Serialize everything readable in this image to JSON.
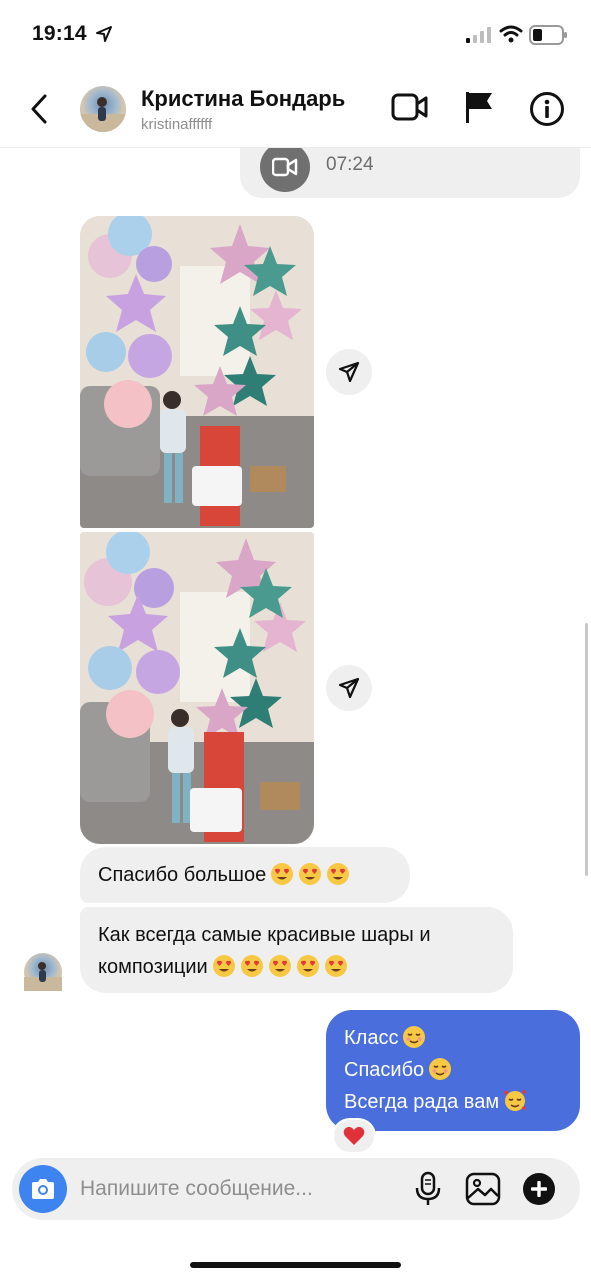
{
  "status_bar": {
    "time": "19:14"
  },
  "header": {
    "contact_name": "Кристина Бондарь",
    "username": "kristinaffffff",
    "icons": [
      "back-arrow-icon",
      "video-call-icon",
      "flag-icon",
      "info-icon"
    ]
  },
  "chat": {
    "call_time": "07:24",
    "photos": [
      "balloons-photo-1",
      "balloons-photo-2"
    ],
    "incoming": [
      {
        "text": "Спасибо большое",
        "emojis": [
          "heart-eyes",
          "heart-eyes",
          "heart-eyes"
        ]
      },
      {
        "text_line1": "Как всегда самые красивые шары и",
        "text_line2": "композиции",
        "emojis": [
          "heart-eyes",
          "heart-eyes",
          "heart-eyes",
          "heart-eyes",
          "heart-eyes"
        ]
      }
    ],
    "outgoing": {
      "line1": "Класс",
      "line2": "Спасибо",
      "line3": "Всегда рада вам",
      "emojis": [
        "relieved-smile",
        "relieved-smile",
        "smiling-hearts"
      ]
    },
    "reaction": "❤️"
  },
  "composer": {
    "placeholder": "Напишите сообщение..."
  },
  "colors": {
    "outgoing_bubble": "#4a6fdc",
    "incoming_bubble": "#efefef",
    "camera_button": "#3d84f0"
  }
}
